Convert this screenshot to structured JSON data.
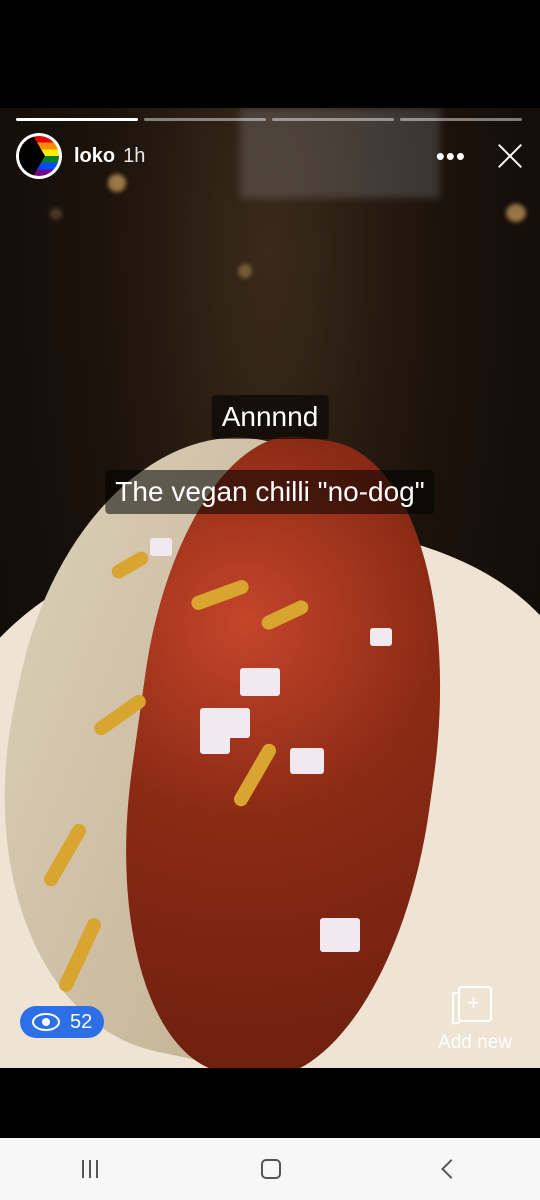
{
  "story": {
    "username": "loko",
    "time": "1h",
    "more_icon": "more-horizontal-icon",
    "close_icon": "close-icon",
    "progress_segments": 4,
    "progress_done": 1
  },
  "captions": [
    "Annnnd",
    "The vegan chilli \"no-dog\""
  ],
  "footer": {
    "views_count": "52",
    "add_new_label": "Add new"
  },
  "colors": {
    "views_badge": "#2d6fe6",
    "background": "#000000"
  },
  "system_nav": {
    "recent_icon": "recent-apps-icon",
    "home_icon": "home-icon",
    "back_icon": "back-icon"
  }
}
